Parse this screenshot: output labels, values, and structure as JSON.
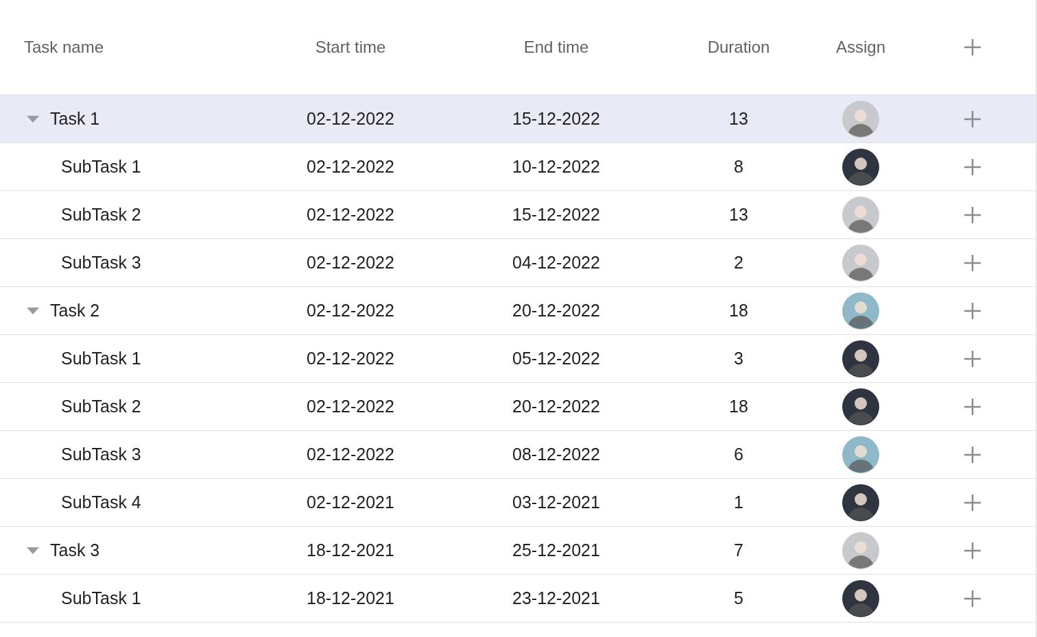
{
  "table": {
    "columns": [
      "Task name",
      "Start time",
      "End time",
      "Duration",
      "Assign"
    ],
    "tasks": [
      {
        "name": "Task 1",
        "start": "02-12-2022",
        "end": "15-12-2022",
        "duration": "13",
        "color": "#c8c9cc",
        "selected": true,
        "expanded": true,
        "children": [
          {
            "name": "SubTask 1",
            "start": "02-12-2022",
            "end": "10-12-2022",
            "duration": "8",
            "color": "#2e3540",
            "selected": false
          },
          {
            "name": "SubTask 2",
            "start": "02-12-2022",
            "end": "15-12-2022",
            "duration": "13",
            "color": "#c8c9cc",
            "selected": false
          },
          {
            "name": "SubTask 3",
            "start": "02-12-2022",
            "end": "04-12-2022",
            "duration": "2",
            "color": "#c8c9cc",
            "selected": false
          }
        ]
      },
      {
        "name": "Task 2",
        "start": "02-12-2022",
        "end": "20-12-2022",
        "duration": "18",
        "color": "#8fb8c8",
        "selected": false,
        "expanded": true,
        "children": [
          {
            "name": "SubTask 1",
            "start": "02-12-2022",
            "end": "05-12-2022",
            "duration": "3",
            "color": "#2e3540",
            "selected": false
          },
          {
            "name": "SubTask 2",
            "start": "02-12-2022",
            "end": "20-12-2022",
            "duration": "18",
            "color": "#2e3540",
            "selected": false
          },
          {
            "name": "SubTask 3",
            "start": "02-12-2022",
            "end": "08-12-2022",
            "duration": "6",
            "color": "#8fb8c8",
            "selected": false
          },
          {
            "name": "SubTask 4",
            "start": "02-12-2021",
            "end": "03-12-2021",
            "duration": "1",
            "color": "#2e3540",
            "selected": false
          }
        ]
      },
      {
        "name": "Task 3",
        "start": "18-12-2021",
        "end": "25-12-2021",
        "duration": "7",
        "color": "#c8c9cc",
        "selected": false,
        "expanded": true,
        "children": [
          {
            "name": "SubTask 1",
            "start": "18-12-2021",
            "end": "23-12-2021",
            "duration": "5",
            "color": "#2e3540",
            "selected": false
          }
        ]
      }
    ]
  }
}
